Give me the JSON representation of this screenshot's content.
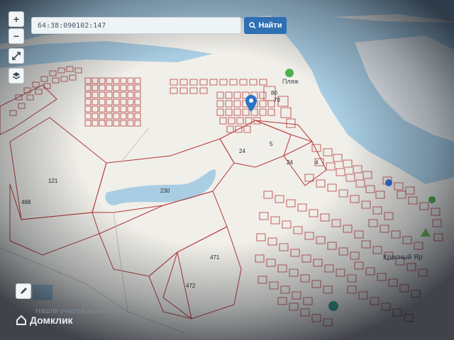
{
  "search": {
    "value": "64:38:090102:147",
    "button_label": "Найти"
  },
  "controls": {
    "zoom_in": "+",
    "zoom_out": "−"
  },
  "map": {
    "parcel_labels": [
      "80",
      "79",
      "24",
      "5",
      "24",
      "4",
      "121",
      "468",
      "230",
      "471",
      "472"
    ],
    "place_labels": [
      "Пляж",
      "Красный Яр"
    ],
    "colors": {
      "water": "#a9cde3",
      "land": "#f3f1ec",
      "parcel_stroke": "#b5383a",
      "marker": "#2b73c6"
    }
  },
  "footer": {
    "help_link": "Нашли участок на карте?",
    "brand": "Домклик"
  }
}
